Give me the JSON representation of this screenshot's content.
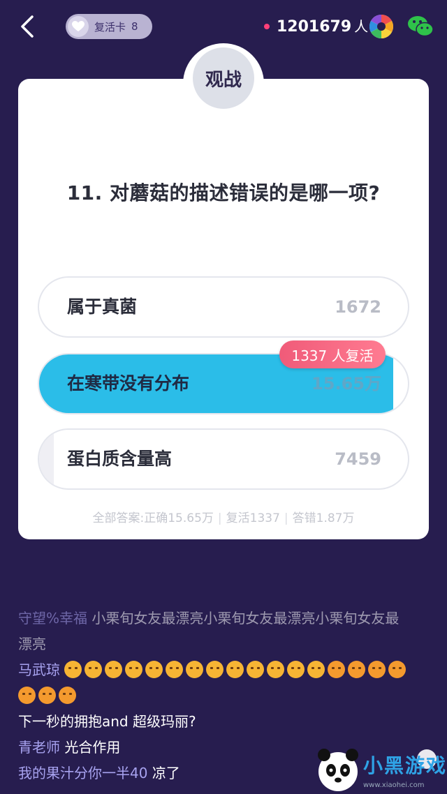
{
  "header": {
    "revive_label": "复活卡",
    "revive_count": "8",
    "viewers": "1201679",
    "viewers_unit": "人"
  },
  "card": {
    "mode_label": "观战",
    "question": "11. 对蘑菇的描述错误的是哪一项?",
    "options": [
      {
        "label": "属于真菌",
        "count": "1672",
        "share": 0.0,
        "correct": false
      },
      {
        "label": "在寒带没有分布",
        "count": "15.65万",
        "share": 0.96,
        "correct": true
      },
      {
        "label": "蛋白质含量高",
        "count": "7459",
        "share": 0.04,
        "correct": false
      }
    ],
    "revive_badge": "1337 人复活",
    "summary": {
      "prefix": "全部答案:",
      "correct": "正确15.65万",
      "revived": "复活1337",
      "wrong": "答错1.87万"
    }
  },
  "comments": [
    {
      "user": "守望%幸福",
      "msg": "小栗旬女友最漂亮小栗旬女友最漂亮小栗旬女友最漂亮"
    },
    {
      "user": "马武琼",
      "msg": ""
    },
    {
      "user": "",
      "msg": "下一秒的拥抱and 超级玛丽?"
    },
    {
      "user": "青老师",
      "msg": "光合作用"
    },
    {
      "user": "我的果汁分你一半40",
      "msg": "凉了"
    }
  ],
  "emoji_row": {
    "frown_count": 13,
    "angry_count": 7
  },
  "watermark": {
    "text": "小黑游戏",
    "url": "www.xiaohei.com"
  },
  "colors": {
    "background": "#271d4f",
    "correct": "#2bbde8",
    "badge": "#f05b79",
    "username": "#a8a3f0"
  }
}
